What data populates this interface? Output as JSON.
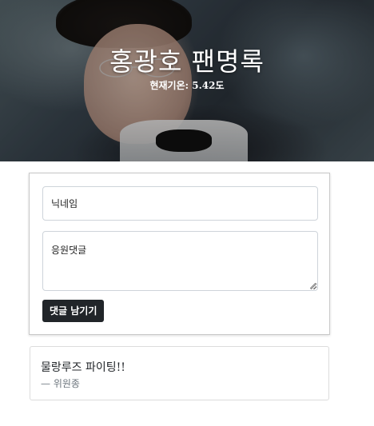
{
  "hero": {
    "title": "홍광호 팬명록",
    "subtitle": "현재기온: 5.42도"
  },
  "form": {
    "nickname_placeholder": "닉네임",
    "comment_placeholder": "응원댓글",
    "submit_label": "댓글 남기기"
  },
  "comments": [
    {
      "text": "물랑루즈 파이팅!!",
      "author": "— 위원종"
    }
  ],
  "colors": {
    "button_bg": "#212529",
    "text": "#212529",
    "muted": "#6c757d"
  }
}
